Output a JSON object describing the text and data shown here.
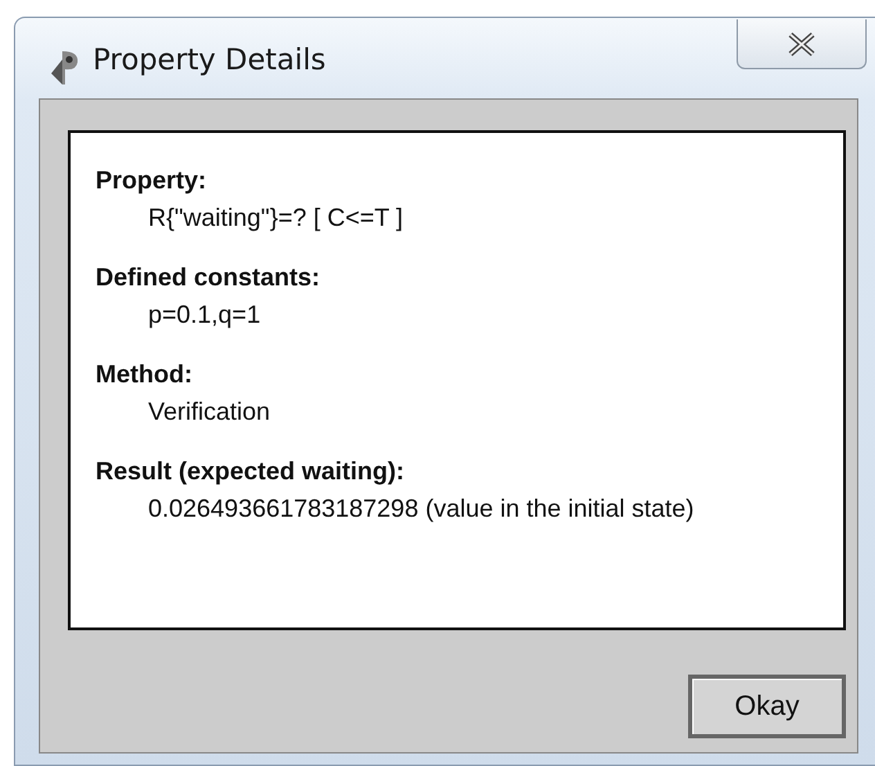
{
  "window": {
    "title": "Property Details"
  },
  "sections": [
    {
      "label": "Property:",
      "value": "R{\"waiting\"}=? [ C<=T ]"
    },
    {
      "label": "Defined constants:",
      "value": "p=0.1,q=1"
    },
    {
      "label": "Method:",
      "value": "Verification"
    },
    {
      "label": "Result (expected waiting):",
      "value": "0.026493661783187298 (value in the initial state)"
    }
  ],
  "buttons": [
    "Okay"
  ]
}
